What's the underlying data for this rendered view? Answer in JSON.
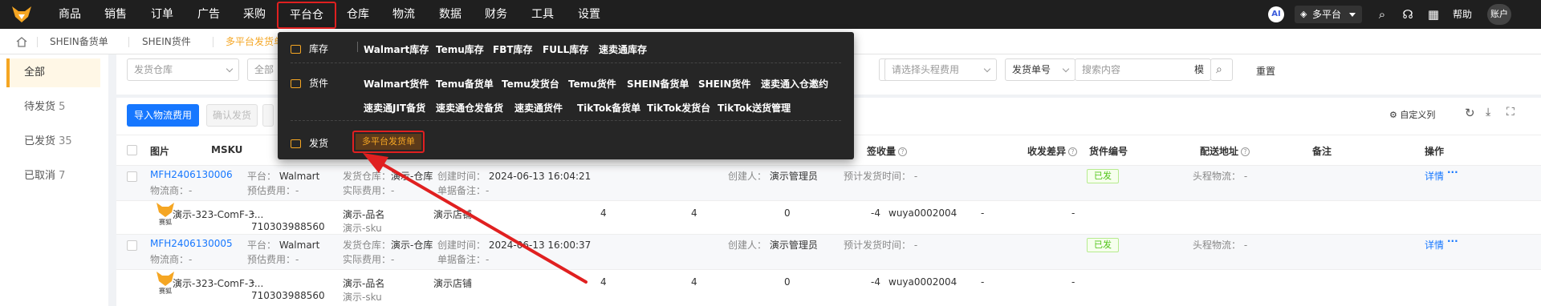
{
  "topnav": {
    "items": [
      "商品",
      "销售",
      "订单",
      "广告",
      "采购",
      "平台仓",
      "仓库",
      "物流",
      "数据",
      "财务",
      "工具",
      "设置"
    ],
    "active": "平台仓",
    "ai_badge": "AI",
    "platform": "多平台",
    "help": "帮助",
    "account": "账户"
  },
  "tabs": {
    "items": [
      "SHEIN备货单",
      "SHEIN货件",
      "多平台发货单"
    ],
    "active": "多平台发货单"
  },
  "sidebar": {
    "items": [
      {
        "label": "全部",
        "count": ""
      },
      {
        "label": "待发货",
        "count": "5"
      },
      {
        "label": "已发货",
        "count": "35"
      },
      {
        "label": "已取消",
        "count": "7"
      }
    ]
  },
  "filters": {
    "warehouse": "发货仓库",
    "all": "全部",
    "head_cost": "请选择头程费用",
    "doc_no": "发货单号",
    "search_placeholder": "搜索内容",
    "mode": "模",
    "reset": "重置"
  },
  "toolbar": {
    "import_cost": "导入物流费用",
    "confirm_ship": "确认发货",
    "custom_cols": "自定义列"
  },
  "columns": {
    "image": "图片",
    "msku": "MSKU",
    "received": "签收量",
    "diff": "收发差异",
    "shipment_no": "货件编号",
    "address": "配送地址",
    "remark": "备注",
    "action": "操作"
  },
  "orders": [
    {
      "id": "MFH2406130006",
      "supplier_label": "物流商：",
      "supplier": "-",
      "platform_label": "平台：",
      "platform": "Walmart",
      "est_cost_label": "预估费用：",
      "est_cost": "-",
      "warehouse_label": "发货仓库：",
      "warehouse": "演示-仓库",
      "actual_cost_label": "实际费用：",
      "actual_cost": "-",
      "created_label": "创建时间：",
      "created": "2024-06-13 16:04:21",
      "note_label": "单据备注：",
      "note": "-",
      "creator_label": "创建人：",
      "creator": "演示管理员",
      "planned_label": "预计发货时间：",
      "planned": "-",
      "status": "已发",
      "head_label": "头程物流：",
      "head": "-",
      "detail": "详情",
      "more": "···",
      "item": {
        "logo_text": "赛狐",
        "msku": "演示-323-ComF-3...",
        "fnsku_dash": "-",
        "fnsku": "710303988560",
        "product_name": "演示-品名",
        "sku": "演示-sku",
        "shop": "演示店铺",
        "qty1": "4",
        "qty2": "4",
        "received": "0",
        "diff": "-4",
        "shipment": "wuya0002004",
        "address": "-",
        "remark": "-"
      }
    },
    {
      "id": "MFH2406130005",
      "supplier_label": "物流商：",
      "supplier": "-",
      "platform_label": "平台：",
      "platform": "Walmart",
      "est_cost_label": "预估费用：",
      "est_cost": "-",
      "warehouse_label": "发货仓库：",
      "warehouse": "演示-仓库",
      "actual_cost_label": "实际费用：",
      "actual_cost": "-",
      "created_label": "创建时间：",
      "created": "2024-06-13 16:00:37",
      "note_label": "单据备注：",
      "note": "-",
      "creator_label": "创建人：",
      "creator": "演示管理员",
      "planned_label": "预计发货时间：",
      "planned": "-",
      "status": "已发",
      "head_label": "头程物流：",
      "head": "-",
      "detail": "详情",
      "more": "···",
      "item": {
        "logo_text": "赛狐",
        "msku": "演示-323-ComF-3...",
        "fnsku_dash": "-",
        "fnsku": "710303988560",
        "product_name": "演示-品名",
        "sku": "演示-sku",
        "shop": "演示店铺",
        "qty1": "4",
        "qty2": "4",
        "received": "0",
        "diff": "-4",
        "shipment": "wuya0002004",
        "address": "-",
        "remark": "-"
      }
    }
  ],
  "menu": {
    "categories": [
      {
        "label": "库存",
        "items": [
          "Walmart库存",
          "Temu库存",
          "FBT库存",
          "FULL库存",
          "速卖通库存"
        ]
      },
      {
        "label": "货件",
        "items": [
          "Walmart货件",
          "Temu备货单",
          "Temu发货台",
          "Temu货件",
          "SHEIN备货单",
          "SHEIN货件",
          "速卖通入仓邀约",
          "速卖通JIT备货",
          "速卖通仓发备货",
          "速卖通货件",
          "TikTok备货单",
          "TikTok发货台",
          "TikTok送货管理"
        ]
      },
      {
        "label": "发货",
        "items": [
          "多平台发货单"
        ]
      }
    ]
  },
  "colors": {
    "accent": "#f5a623",
    "link": "#1677ff",
    "annotation": "#e02020",
    "topbar": "#1f1f1f"
  }
}
